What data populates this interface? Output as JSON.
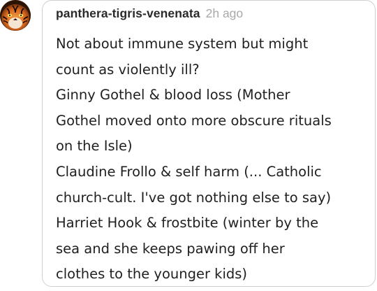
{
  "avatar": {
    "icon": "tiger-avatar-icon",
    "accent": "#c8561a"
  },
  "comment": {
    "username": "panthera-tigris-venenata",
    "timestamp": "2h ago",
    "lines": [
      "Not about immune system but might",
      "count as violently ill?",
      "Ginny Gothel & blood loss (Mother",
      "Gothel moved onto more obscure rituals",
      "on the Isle)",
      "Claudine Frollo & self harm (... Catholic",
      "church-cult. I've got nothing else to say)",
      "Harriet Hook & frostbite (winter by the",
      "sea and she keeps pawing off her",
      "clothes to the younger kids)"
    ]
  },
  "colors": {
    "username": "#2a2a2a",
    "timestamp": "#a9a9a9",
    "text": "#1f1f1f",
    "border": "#cfcfcf"
  }
}
